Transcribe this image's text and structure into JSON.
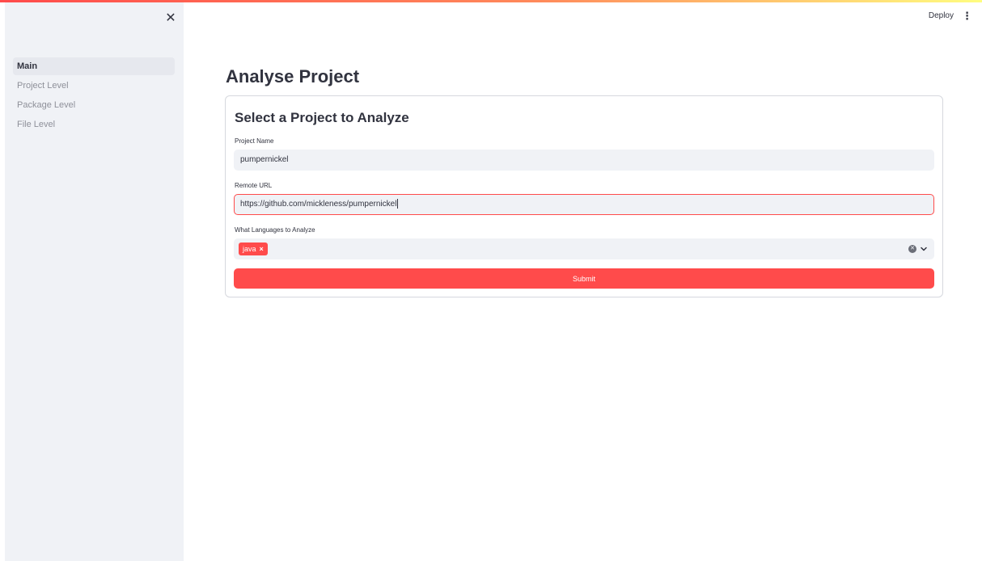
{
  "header": {
    "deploy_label": "Deploy",
    "menu_icon": "vertical-dots-icon"
  },
  "sidebar": {
    "close_icon": "close-icon",
    "items": [
      {
        "label": "Main",
        "active": true
      },
      {
        "label": "Project Level",
        "active": false
      },
      {
        "label": "Package Level",
        "active": false
      },
      {
        "label": "File Level",
        "active": false
      }
    ]
  },
  "page": {
    "title": "Analyse Project"
  },
  "form": {
    "heading": "Select a Project to Analyze",
    "project_name": {
      "label": "Project Name",
      "value": "pumpernickel"
    },
    "remote_url": {
      "label": "Remote URL",
      "value": "https://github.com/mickleness/pumpernickel"
    },
    "languages": {
      "label": "What Languages to Analyze",
      "selected": [
        "java"
      ]
    },
    "submit_label": "Submit"
  },
  "colors": {
    "accent": "#ff4b4b",
    "sidebar_bg": "#f0f2f6",
    "text": "#31333f"
  }
}
